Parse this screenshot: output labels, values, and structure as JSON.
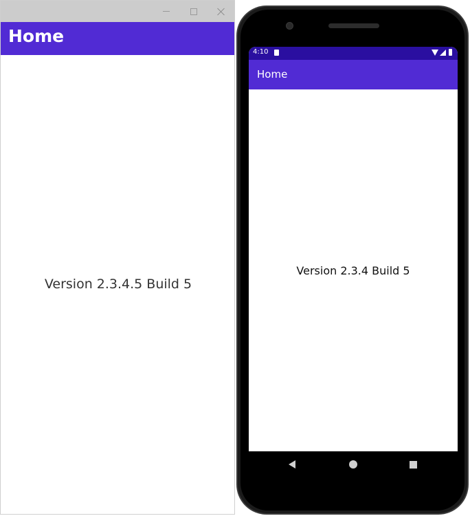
{
  "desktop_window": {
    "appbar_title": "Home",
    "version_text": "Version 2.3.4.5 Build 5",
    "controls": [
      "minimize-icon",
      "maximize-icon",
      "close-icon"
    ]
  },
  "phone": {
    "status_time": "4:10",
    "status_icons": [
      "sd-card-icon",
      "wifi-icon",
      "signal-icon",
      "battery-icon"
    ],
    "appbar_title": "Home",
    "version_text": "Version 2.3.4 Build 5",
    "nav_buttons": [
      "back-icon",
      "home-icon",
      "recents-icon"
    ]
  },
  "colors": {
    "accent": "#512bd4",
    "status_bar": "#2a0fa0",
    "window_titlebar": "#cccccc"
  }
}
